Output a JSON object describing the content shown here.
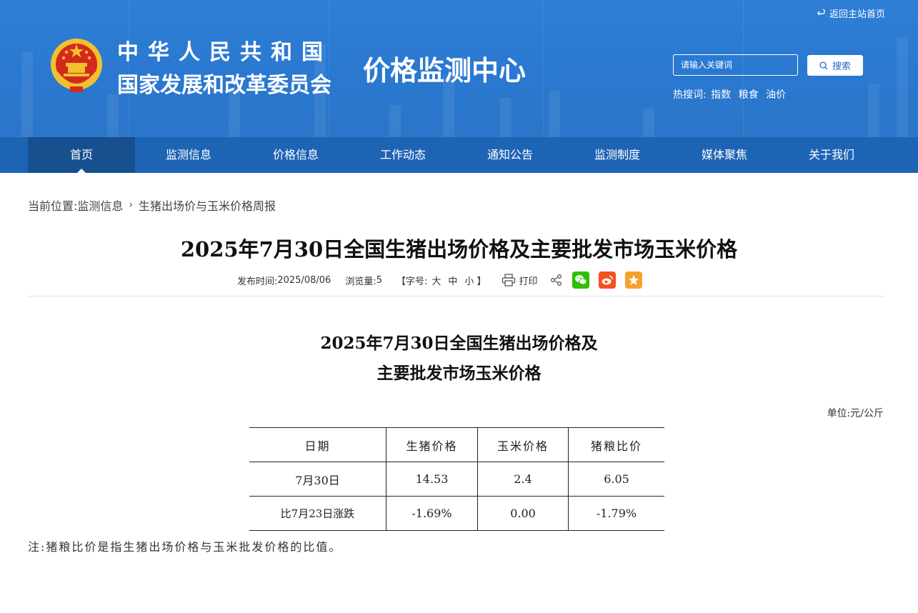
{
  "header": {
    "back_home": "返回主站首页",
    "org_name_line1": "中华人民共和国",
    "org_name_line2": "国家发展和改革委员会",
    "site_title": "价格监测中心",
    "search": {
      "placeholder": "请输入关键词",
      "button_label": "搜索"
    },
    "hot_search": {
      "label": "热搜词:",
      "terms": [
        "指数",
        "粮食",
        "油价"
      ]
    }
  },
  "nav": {
    "items": [
      "首页",
      "监测信息",
      "价格信息",
      "工作动态",
      "通知公告",
      "监测制度",
      "媒体聚焦",
      "关于我们"
    ],
    "active": "首页"
  },
  "breadcrumb": {
    "label": "当前位置:",
    "items": [
      "监测信息",
      "生猪出场价与玉米价格周报"
    ]
  },
  "article": {
    "title": "2025年7月30日全国生猪出场价格及主要批发市场玉米价格",
    "meta": {
      "publish_label": "发布时间:",
      "publish_date": "2025/08/06",
      "views_label": "浏览量:",
      "views": "5",
      "font_label": "【字号:",
      "font_sizes": [
        "大",
        "中",
        "小"
      ],
      "font_close": "】",
      "print_label": "打印"
    },
    "content": {
      "title_line1": "2025年7月30日全国生猪出场价格及",
      "title_line2": "主要批发市场玉米价格",
      "unit": "单位:元/公斤",
      "table": {
        "headers": [
          "日期",
          "生猪价格",
          "玉米价格",
          "猪粮比价"
        ],
        "rows": [
          [
            "7月30日",
            "14.53",
            "2.4",
            "6.05"
          ],
          [
            "比7月23日涨跌",
            "-1.69%",
            "0.00",
            "-1.79%"
          ]
        ]
      },
      "note": "注:猪粮比价是指生猪出场价格与玉米批发价格的比值。"
    }
  },
  "colors": {
    "header_blue": "#2a78d0",
    "nav_blue": "#1e64b4",
    "nav_active": "#17508f",
    "wechat": "#2dc100",
    "weibo": "#f4511e",
    "favorite": "#f7a12d"
  }
}
